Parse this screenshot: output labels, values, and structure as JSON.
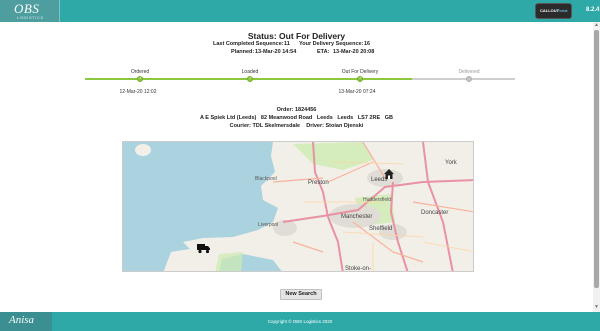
{
  "header": {
    "logo_text": "OBS",
    "logo_subtext": "LOGISTICS",
    "badge_primary": "CALLOUT",
    "badge_secondary": "Portal",
    "corner_text": "8.2.4"
  },
  "status": {
    "title": "Status: Out For Delivery",
    "last_completed_label": "Last Completed Sequence:",
    "last_completed_value": "11",
    "your_delivery_label": "Your Delivery Sequence:",
    "your_delivery_value": "16",
    "planned_label": "Planned:",
    "planned_value": "13-Mar-20 14:54",
    "eta_label": "ETA:",
    "eta_value": "13-Mar-20 20:08"
  },
  "progress": {
    "stages": [
      {
        "label": "Ordered",
        "date": "12-Mar-20 12:02",
        "state": "done"
      },
      {
        "label": "Loaded",
        "date": "",
        "state": "done"
      },
      {
        "label": "Out For Delivery",
        "date": "13-Mar-20 07:24",
        "state": "done"
      },
      {
        "label": "Delivered",
        "date": "",
        "state": "pending"
      }
    ],
    "completed_fraction": 0.76
  },
  "order": {
    "order_label": "Order:",
    "order_value": "1824456",
    "address": "A E Spiek Ltd (Leeds)   82 Meanwood Road   Leeds   Leeds   LS7 2RE   GB",
    "courier_label": "Courier:",
    "courier_value": "TDL Skelmersdale",
    "driver_label": "Driver:",
    "driver_value": "Stoian Djenski"
  },
  "map": {
    "labels": {
      "blackpool": "Blackpool",
      "preston": "Preston",
      "leeds": "Leeds",
      "york": "York",
      "manchester": "Manchester",
      "liverpool": "Liverpool",
      "sheffield": "Sheffield",
      "doncaster": "Doncaster",
      "huddersfield": "Huddersfield",
      "stoke": "Stoke-on-"
    },
    "colors": {
      "sea": "#aad3df",
      "land": "#f2efe9",
      "motorway": "#e892a2",
      "trunk": "#f9b29c",
      "park": "#cdebb0"
    }
  },
  "actions": {
    "new_search": "New Search"
  },
  "footer": {
    "logo_text": "Anisa",
    "copyright": "Copyright © OBS Logistics 2020"
  }
}
